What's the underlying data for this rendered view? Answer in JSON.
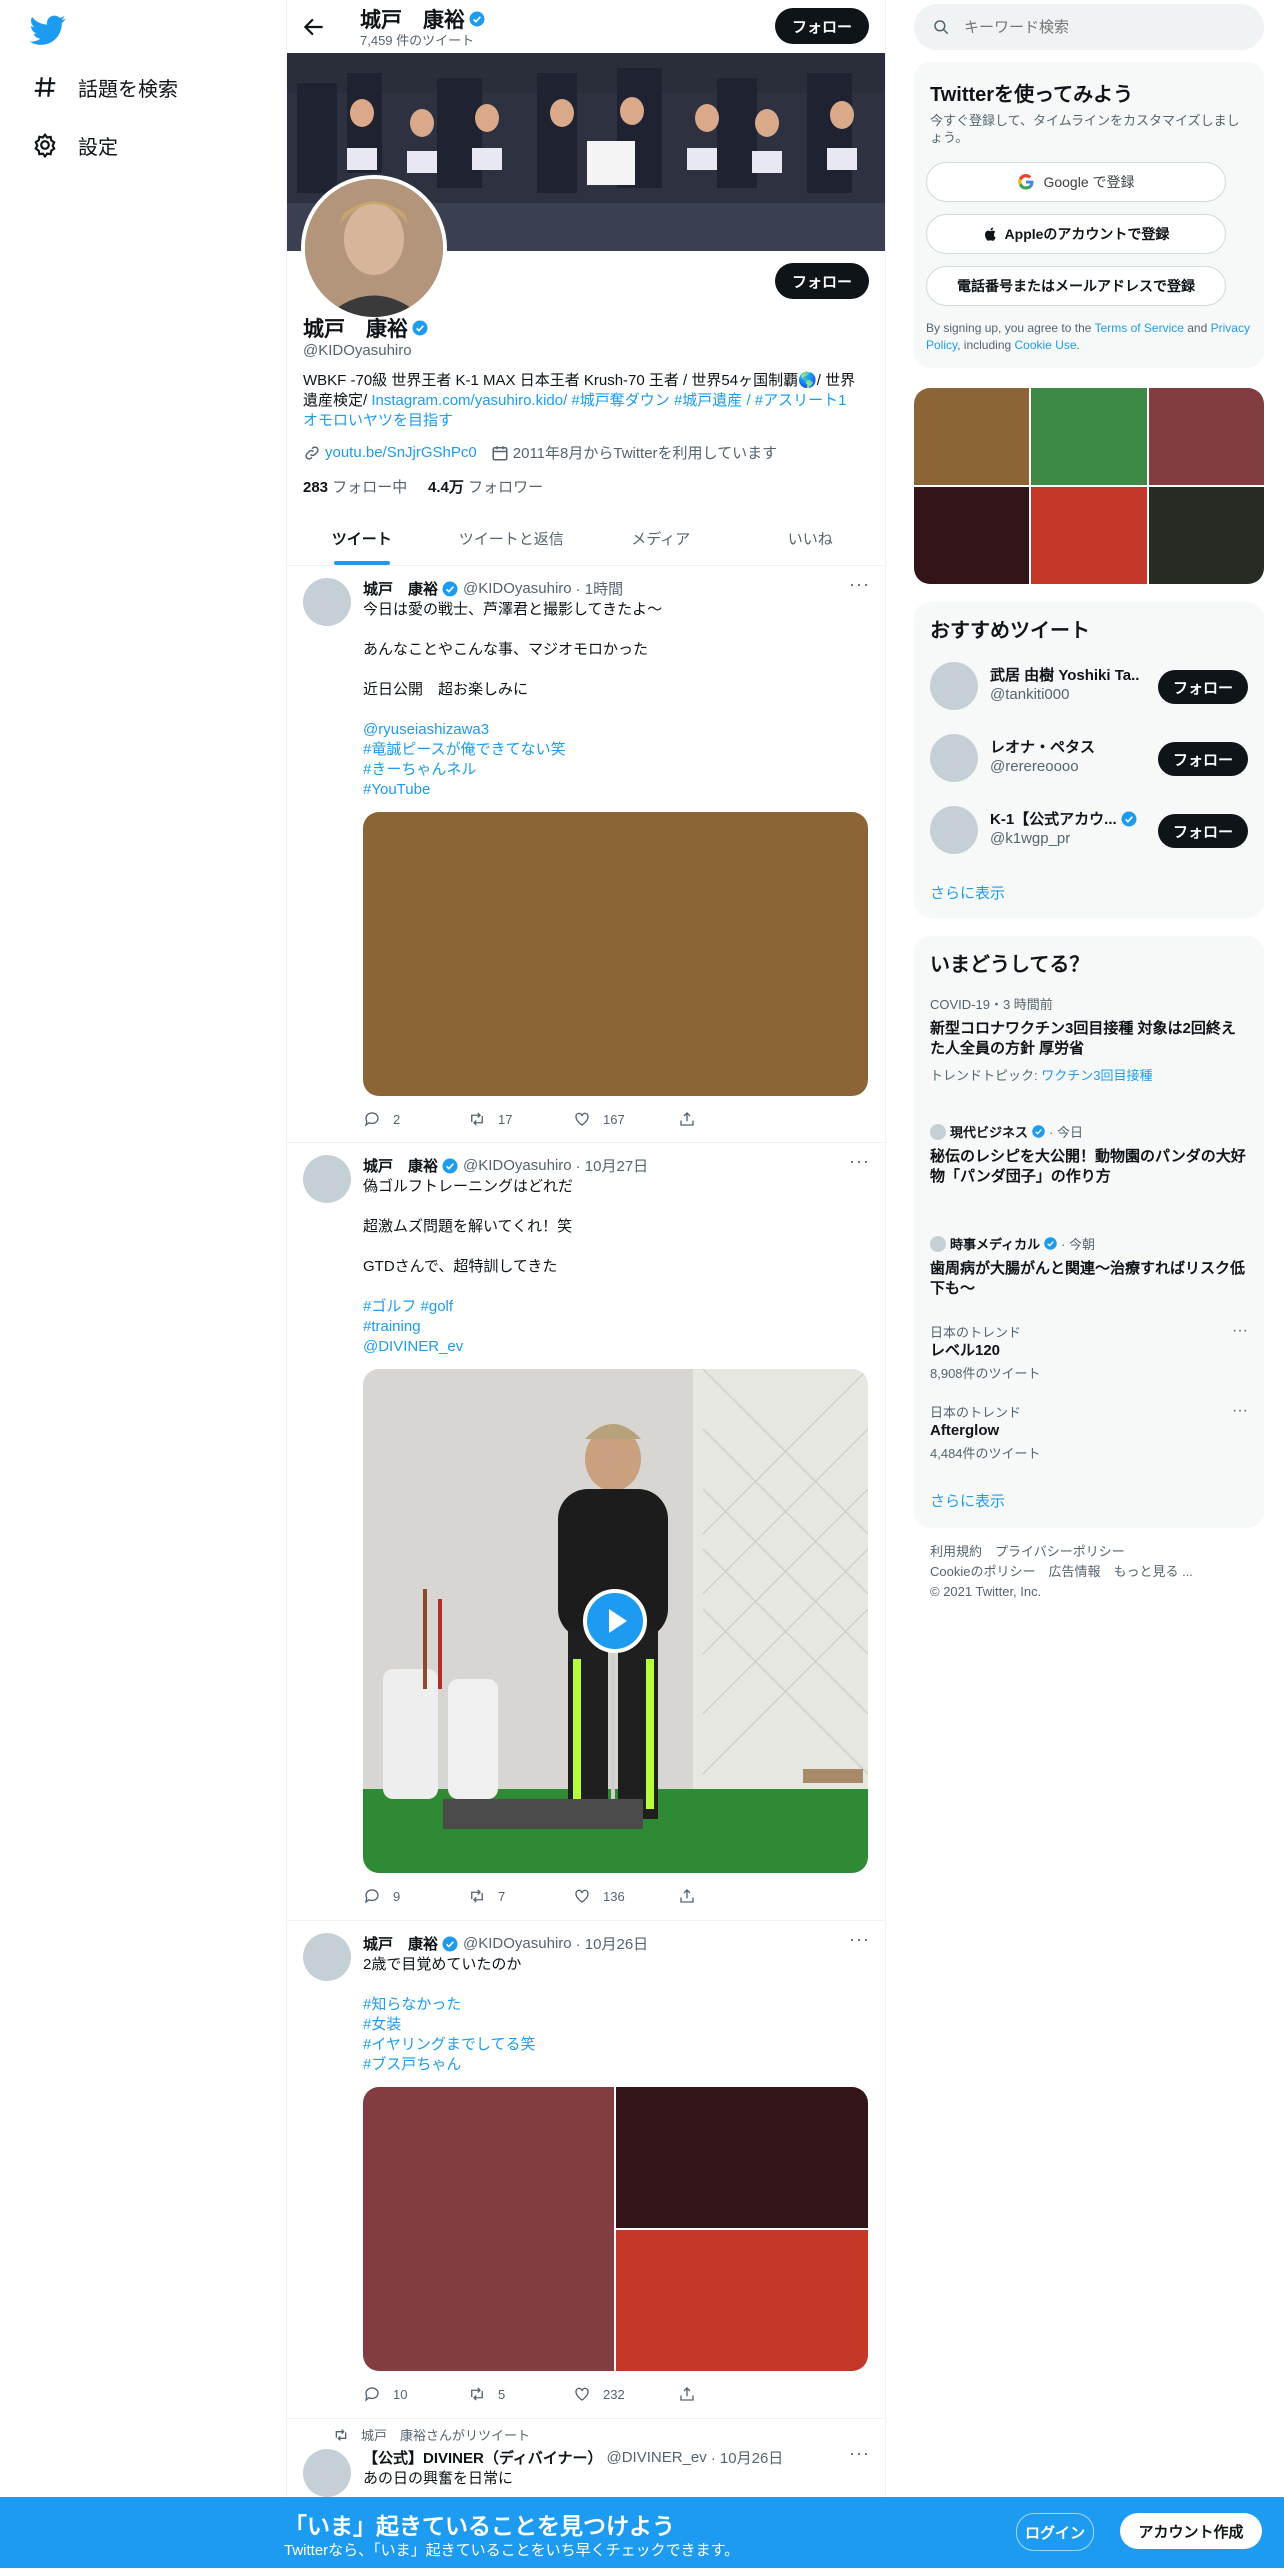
{
  "nav": {
    "items": [
      {
        "label": "話題を検索",
        "icon": "hashtag-icon"
      },
      {
        "label": "設定",
        "icon": "gear-icon"
      }
    ]
  },
  "header": {
    "name": "城戸　康裕",
    "tweet_count": "7,459 件のツイート",
    "follow_label": "フォロー"
  },
  "profile": {
    "name": "城戸　康裕",
    "handle": "@KIDOyasuhiro",
    "follow_label": "フォロー",
    "bio_text": "WBKF -70級 世界王者 K-1 MAX 日本王者 Krush-70 王者 / 世界54ヶ国制覇🌎/ 世界遺産検定/ ",
    "bio_link": "Instagram.com/yasuhiro.kido/",
    "bio_tags": " #城戸奪ダウン #城戸遺産 / #アスリート1",
    "bio_tail": "オモロいヤツを目指す",
    "website": "youtu.be/SnJjrGShPc0",
    "joined": "2011年8月からTwitterを利用しています",
    "following_count": "283",
    "following_label": " フォロー中",
    "followers_count": "4.4万",
    "followers_label": " フォロワー"
  },
  "tabs": [
    "ツイート",
    "ツイートと返信",
    "メディア",
    "いいね"
  ],
  "tweets": [
    {
      "name": "城戸　康裕",
      "handle": "@KIDOyasuhiro",
      "time": "· 1時間",
      "lines": [
        "今日は愛の戦士、芦澤君と撮影してきたよ〜",
        "あんなことやこんな事、マジオモロかった",
        "近日公開　超お楽しみに"
      ],
      "tags": [
        "@ryuseiashizawa3",
        "#竜誠ピースが俺できてない笑",
        "#きーちゃんネル",
        "#YouTube"
      ],
      "media_color": "#8b6535",
      "replies": "2",
      "retweets": "17",
      "likes": "167"
    },
    {
      "name": "城戸　康裕",
      "handle": "@KIDOyasuhiro",
      "time": "· 10月27日",
      "lines": [
        "偽ゴルフトレーニングはどれだ",
        "超激ムズ問題を解いてくれ！笑",
        "GTDさんで、超特訓してきた"
      ],
      "tags": [
        "#ゴルフ #golf",
        "#training",
        "@DIVINER_ev"
      ],
      "replies": "9",
      "retweets": "7",
      "likes": "136"
    },
    {
      "name": "城戸　康裕",
      "handle": "@KIDOyasuhiro",
      "time": "· 10月26日",
      "lines": [
        "2歳で目覚めていたのか"
      ],
      "tags": [
        "#知らなかった",
        "#女装",
        "#イヤリングまでしてる笑",
        "#ブス戸ちゃん"
      ],
      "media_colors": [
        "#833c3f",
        "#331418",
        "#c4382a"
      ],
      "replies": "10",
      "retweets": "5",
      "likes": "232"
    },
    {
      "retweet_label": "城戸　康裕さんがリツイート",
      "name": "【公式】DIVINER（ディバイナー）",
      "handle": "@DIVINER_ev",
      "time": "· 10月26日",
      "lines": [
        "あの日の興奮を日常に"
      ]
    }
  ],
  "right": {
    "search_placeholder": "キーワード検索",
    "signup": {
      "title": "Twitterを使ってみよう",
      "subtitle": "今すぐ登録して、タイムラインをカスタマイズしましょう。",
      "google": "Google で登録",
      "apple": "Appleのアカウントで登録",
      "phone": "電話番号またはメールアドレスで登録",
      "terms_pre": "By signing up, you agree to the ",
      "terms": "Terms of Service",
      "and": " and ",
      "privacy": "Privacy Policy",
      "including": ", including ",
      "cookie": "Cookie Use",
      "dot": "."
    },
    "media_grid": [
      "#8b6535",
      "#3c8a46",
      "#833c3f",
      "#331418",
      "#c4382a",
      "#262b24"
    ],
    "recommend": {
      "title": "おすすめツイート",
      "users": [
        {
          "name": "武居 由樹 Yoshiki Ta...",
          "handle": "@tankiti000",
          "verified": false
        },
        {
          "name": "レオナ・ペタス",
          "handle": "@rerereoooo",
          "verified": false
        },
        {
          "name": "K-1【公式アカウ...",
          "handle": "@k1wgp_pr",
          "verified": true
        }
      ],
      "follow_label": "フォロー",
      "more": "さらに表示"
    },
    "trends": {
      "title": "いまどうしてる？",
      "items": [
        {
          "context": "COVID-19・3 時間前",
          "title": "新型コロナワクチン3回目接種 対象は2回終えた人全員の方針 厚労省",
          "sub_label": "トレンドトピック: ",
          "sub_link": "ワクチン3回目接種"
        },
        {
          "context": "現代ビジネス",
          "time": "· 今日",
          "title": "秘伝のレシピを大公開！動物園のパンダの大好物「パンダ団子」の作り方"
        },
        {
          "context": "時事メディカル",
          "time": "· 今朝",
          "title": "歯周病が大腸がんと関連～治療すればリスク低下も～"
        },
        {
          "context": "日本のトレンド",
          "title": "レベル120",
          "sub": "8,908件のツイート"
        },
        {
          "context": "日本のトレンド",
          "title": "Afterglow",
          "sub": "4,484件のツイート"
        }
      ],
      "more": "さらに表示"
    },
    "footer": {
      "line1": "利用規約　プライバシーポリシー",
      "line2": "Cookieのポリシー　広告情報　もっと見る ...",
      "line3": "© 2021 Twitter, Inc."
    }
  },
  "bottom": {
    "title": "「いま」起きていることを見つけよう",
    "subtitle": "Twitterなら、「いま」起きていることをいち早くチェックできます。",
    "login": "ログイン",
    "signup": "アカウント作成"
  },
  "colors": {
    "accent": "#1d9bf0",
    "text": "#0f1419",
    "muted": "#536471"
  }
}
